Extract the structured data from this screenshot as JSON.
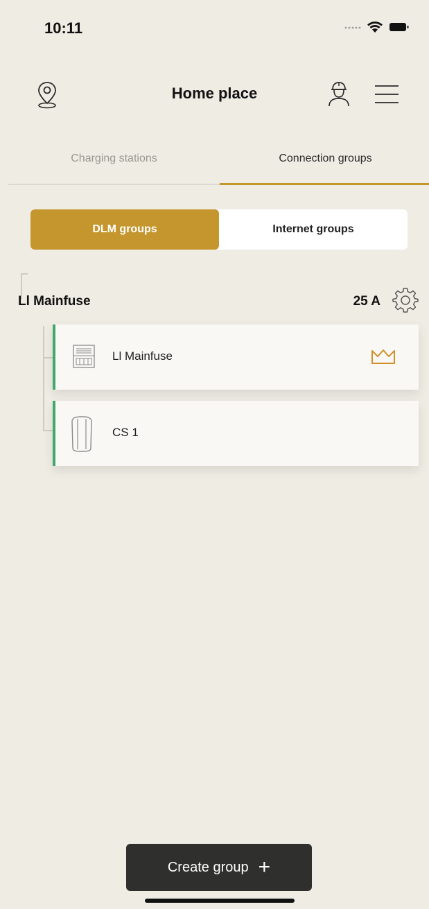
{
  "status_bar": {
    "time": "10:11"
  },
  "header": {
    "title": "Home place",
    "icons": [
      "location-icon",
      "worker-icon",
      "menu-icon"
    ]
  },
  "tabs": [
    {
      "label": "Charging stations",
      "active": false
    },
    {
      "label": "Connection groups",
      "active": true
    }
  ],
  "segments": {
    "dlm": "DLM groups",
    "internet": "Internet groups",
    "selected": "DLM groups"
  },
  "group": {
    "name": "Ll Mainfuse",
    "current": "25 A"
  },
  "devices": [
    {
      "label": "Ll Mainfuse",
      "icon": "meter-icon",
      "master": true
    },
    {
      "label": "CS 1",
      "icon": "charging-station-icon",
      "master": false
    }
  ],
  "actions": {
    "create_group": "Create group",
    "create_group_icon": "+"
  },
  "colors": {
    "accent": "#c4962d",
    "background": "#efece4",
    "card_accent": "#3fa86a",
    "button_dark": "#2f2f2d"
  }
}
